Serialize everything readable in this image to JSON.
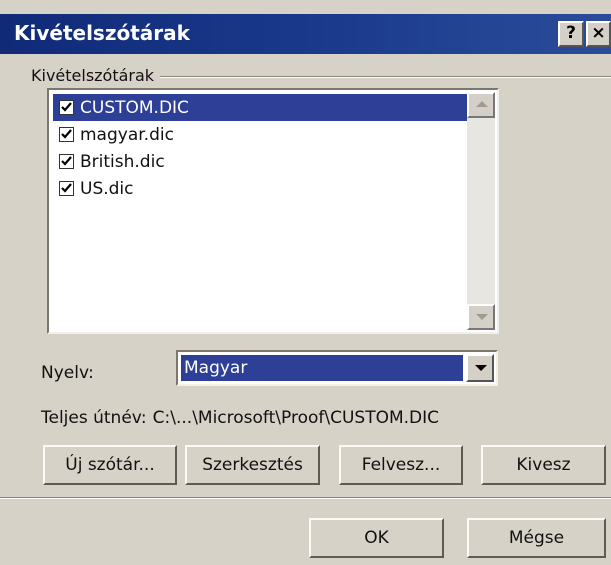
{
  "window": {
    "title": "Kivételszótárak",
    "help_button": "?",
    "close_button": "×"
  },
  "group": {
    "label": "Kivételszótárak"
  },
  "dictionaries": [
    {
      "name": "CUSTOM.DIC",
      "checked": true,
      "selected": true
    },
    {
      "name": "magyar.dic",
      "checked": true,
      "selected": false
    },
    {
      "name": "British.dic",
      "checked": true,
      "selected": false
    },
    {
      "name": "US.dic",
      "checked": true,
      "selected": false
    }
  ],
  "language": {
    "label": "Nyelv:",
    "value": "Magyar"
  },
  "path": {
    "label": "Teljes útnév:",
    "value": "C:\\...\\Microsoft\\Proof\\CUSTOM.DIC"
  },
  "buttons": {
    "new": "Új szótár...",
    "edit": "Szerkesztés",
    "add": "Felvesz...",
    "remove": "Kivesz",
    "ok": "OK",
    "cancel": "Mégse"
  },
  "colors": {
    "title_bar": "#102a78",
    "selection": "#2d3f97",
    "dialog_face": "#d7d2c8"
  }
}
